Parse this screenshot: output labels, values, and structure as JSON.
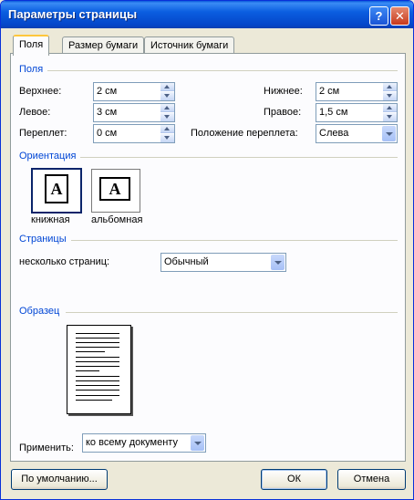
{
  "window": {
    "title": "Параметры страницы",
    "help": "?",
    "close": "✕"
  },
  "tabs": [
    "Поля",
    "Размер бумаги",
    "Источник бумаги"
  ],
  "margins": {
    "group": "Поля",
    "top_label": "Верхнее:",
    "top_value": "2 см",
    "bottom_label": "Нижнее:",
    "bottom_value": "2 см",
    "left_label": "Левое:",
    "left_value": "3 см",
    "right_label": "Правое:",
    "right_value": "1,5 см",
    "gutter_label": "Переплет:",
    "gutter_value": "0 см",
    "gutter_pos_label": "Положение переплета:",
    "gutter_pos_value": "Слева"
  },
  "orientation": {
    "group": "Ориентация",
    "portrait": "книжная",
    "landscape": "альбомная",
    "glyph": "A"
  },
  "pages": {
    "group": "Страницы",
    "multiple_label": "несколько страниц:",
    "multiple_value": "Обычный"
  },
  "preview": {
    "group": "Образец"
  },
  "apply": {
    "label": "Применить:",
    "value": "ко всему документу"
  },
  "buttons": {
    "default": "По умолчанию...",
    "ok": "ОК",
    "cancel": "Отмена"
  }
}
